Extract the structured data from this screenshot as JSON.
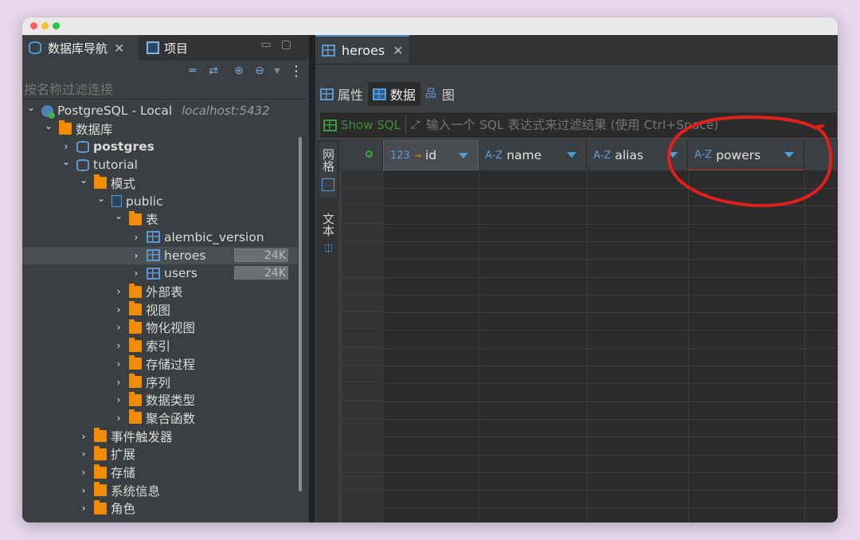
{
  "navigator": {
    "tabs": [
      {
        "label": "数据库导航",
        "icon": "database-icon",
        "close": "✕"
      },
      {
        "label": "项目",
        "icon": "project-icon"
      }
    ],
    "filter_placeholder": "按名称过滤连接",
    "tree": [
      {
        "label": "PostgreSQL - Local",
        "host": "localhost:5432",
        "icon": "postgresql-icon",
        "level": 0,
        "expanded": true
      },
      {
        "label": "数据库",
        "icon": "folder-icon",
        "level": 1,
        "expanded": true
      },
      {
        "label": "postgres",
        "icon": "database-icon",
        "level": 2,
        "expanded": false,
        "bold": true
      },
      {
        "label": "tutorial",
        "icon": "database-icon",
        "level": 2,
        "expanded": true
      },
      {
        "label": "模式",
        "icon": "folder-icon",
        "level": 3,
        "expanded": true
      },
      {
        "label": "public",
        "icon": "schema-icon",
        "level": 4,
        "expanded": true
      },
      {
        "label": "表",
        "icon": "folder-icon",
        "level": 5,
        "expanded": true
      },
      {
        "label": "alembic_version",
        "icon": "table-icon",
        "level": 6
      },
      {
        "label": "heroes",
        "icon": "table-icon",
        "level": 6,
        "size": "24K",
        "selected": true
      },
      {
        "label": "users",
        "icon": "table-icon",
        "level": 6,
        "size": "24K"
      },
      {
        "label": "外部表",
        "icon": "folder-icon",
        "level": 5
      },
      {
        "label": "视图",
        "icon": "folder-icon",
        "level": 5
      },
      {
        "label": "物化视图",
        "icon": "folder-icon",
        "level": 5
      },
      {
        "label": "索引",
        "icon": "folder-icon",
        "level": 5
      },
      {
        "label": "存储过程",
        "icon": "folder-icon",
        "level": 5
      },
      {
        "label": "序列",
        "icon": "folder-icon",
        "level": 5
      },
      {
        "label": "数据类型",
        "icon": "folder-icon",
        "level": 5
      },
      {
        "label": "聚合函数",
        "icon": "folder-icon",
        "level": 5
      },
      {
        "label": "事件触发器",
        "icon": "folder-icon",
        "level": 3
      },
      {
        "label": "扩展",
        "icon": "folder-icon",
        "level": 3
      },
      {
        "label": "存储",
        "icon": "folder-icon",
        "level": 3
      },
      {
        "label": "系统信息",
        "icon": "folder-icon",
        "level": 3
      },
      {
        "label": "角色",
        "icon": "folder-icon",
        "level": 3
      }
    ]
  },
  "editor": {
    "tab": {
      "label": "heroes",
      "close": "✕"
    },
    "subtabs": [
      {
        "label": "属性",
        "icon": "table-icon"
      },
      {
        "label": "数据",
        "icon": "data-icon",
        "active": true
      },
      {
        "label": "图",
        "icon": "diagram-icon"
      }
    ],
    "show_sql": "Show SQL",
    "filter_placeholder": "输入一个 SQL 表达式来过滤结果 (使用 Ctrl+Space)",
    "side_tabs": [
      "网格",
      "文本"
    ],
    "columns": [
      {
        "type": "123",
        "name": "id",
        "key": true
      },
      {
        "type": "A-Z",
        "name": "name"
      },
      {
        "type": "A-Z",
        "name": "alias"
      },
      {
        "type": "A-Z",
        "name": "powers"
      }
    ]
  },
  "colors": {
    "accent": "#4a9fdc",
    "annotation": "#e0201c",
    "folder": "#f08c00"
  }
}
